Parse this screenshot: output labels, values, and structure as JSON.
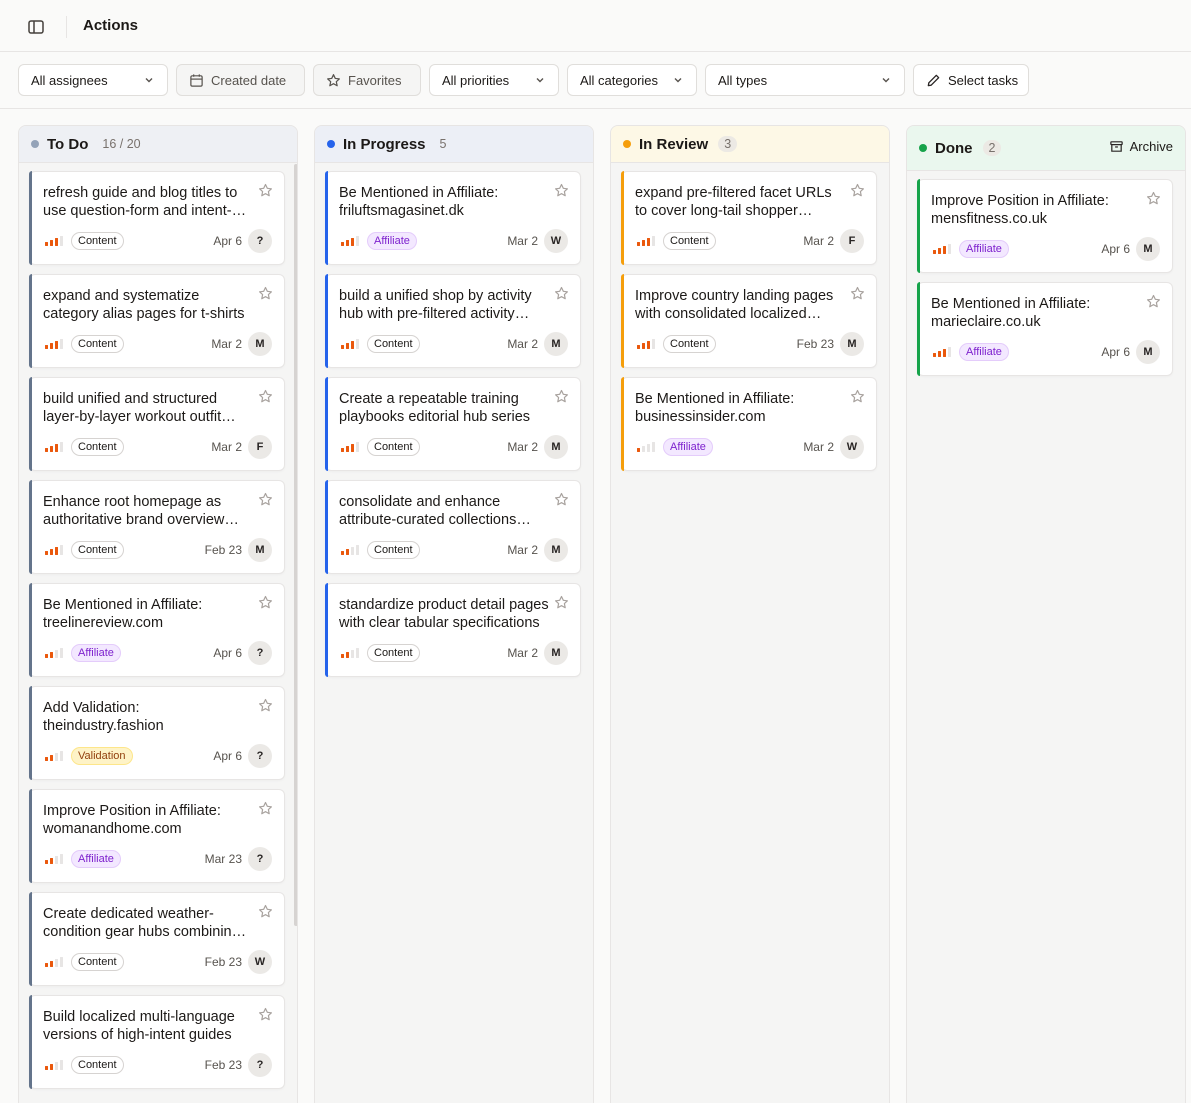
{
  "header": {
    "title": "Actions"
  },
  "filters": {
    "assignees": "All assignees",
    "created_date": "Created date",
    "favorites": "Favorites",
    "priorities": "All priorities",
    "categories": "All categories",
    "types": "All types",
    "select_tasks": "Select tasks"
  },
  "colors": {
    "todo": "#94a3b8",
    "in_progress": "#2563eb",
    "in_review": "#f59e0b",
    "done": "#16a34a",
    "priority_high": "#ea580c"
  },
  "columns": {
    "todo": {
      "title": "To Do",
      "count": "16 / 20",
      "cards": [
        {
          "title": "refresh guide and blog titles to use question-form and intent-based formats",
          "tag": "Content",
          "date": "Apr 6",
          "assignee": "?",
          "priority": 3
        },
        {
          "title": "expand and systematize category alias pages for t-shirts",
          "tag": "Content",
          "date": "Mar 2",
          "assignee": "M",
          "priority": 3
        },
        {
          "title": "build unified and structured layer-by-layer workout outfit guides",
          "tag": "Content",
          "date": "Mar 2",
          "assignee": "F",
          "priority": 3
        },
        {
          "title": "Enhance root homepage as authoritative brand overview page",
          "tag": "Content",
          "date": "Feb 23",
          "assignee": "M",
          "priority": 3
        },
        {
          "title": "Be Mentioned in Affiliate: treelinereview.com",
          "tag": "Affiliate",
          "date": "Apr 6",
          "assignee": "?",
          "priority": 2
        },
        {
          "title": "Add Validation: theindustry.fashion",
          "tag": "Validation",
          "date": "Apr 6",
          "assignee": "?",
          "priority": 2
        },
        {
          "title": "Improve Position in Affiliate: womanandhome.com",
          "tag": "Affiliate",
          "date": "Mar 23",
          "assignee": "?",
          "priority": 2
        },
        {
          "title": "Create dedicated weather-condition gear hubs combining products",
          "tag": "Content",
          "date": "Feb 23",
          "assignee": "W",
          "priority": 2
        },
        {
          "title": "Build localized multi-language versions of high-intent guides",
          "tag": "Content",
          "date": "Feb 23",
          "assignee": "?",
          "priority": 2
        }
      ]
    },
    "in_progress": {
      "title": "In Progress",
      "count": "5",
      "cards": [
        {
          "title": "Be Mentioned in Affiliate: friluftsmagasinet.dk",
          "tag": "Affiliate",
          "date": "Mar 2",
          "assignee": "W",
          "priority": 3
        },
        {
          "title": "build a unified shop by activity hub with pre-filtered activity collections",
          "tag": "Content",
          "date": "Mar 2",
          "assignee": "M",
          "priority": 3
        },
        {
          "title": "Create a repeatable training playbooks editorial hub series",
          "tag": "Content",
          "date": "Mar 2",
          "assignee": "M",
          "priority": 3
        },
        {
          "title": "consolidate and enhance attribute-curated collections pages",
          "tag": "Content",
          "date": "Mar 2",
          "assignee": "M",
          "priority": 2
        },
        {
          "title": "standardize product detail pages with clear tabular specifications",
          "tag": "Content",
          "date": "Mar 2",
          "assignee": "M",
          "priority": 2
        }
      ]
    },
    "in_review": {
      "title": "In Review",
      "count": "3",
      "cards": [
        {
          "title": "expand pre-filtered facet URLs to cover long-tail shopper queries",
          "tag": "Content",
          "date": "Mar 2",
          "assignee": "F",
          "priority": 3
        },
        {
          "title": "Improve country landing pages with consolidated localized content",
          "tag": "Content",
          "date": "Feb 23",
          "assignee": "M",
          "priority": 3
        },
        {
          "title": "Be Mentioned in Affiliate: businessinsider.com",
          "tag": "Affiliate",
          "date": "Mar 2",
          "assignee": "W",
          "priority": 1
        }
      ]
    },
    "done": {
      "title": "Done",
      "count": "2",
      "archive_label": "Archive",
      "cards": [
        {
          "title": "Improve Position in Affiliate: mensfitness.co.uk",
          "tag": "Affiliate",
          "date": "Apr 6",
          "assignee": "M",
          "priority": 3
        },
        {
          "title": "Be Mentioned in Affiliate: marieclaire.co.uk",
          "tag": "Affiliate",
          "date": "Apr 6",
          "assignee": "M",
          "priority": 3
        }
      ]
    }
  }
}
